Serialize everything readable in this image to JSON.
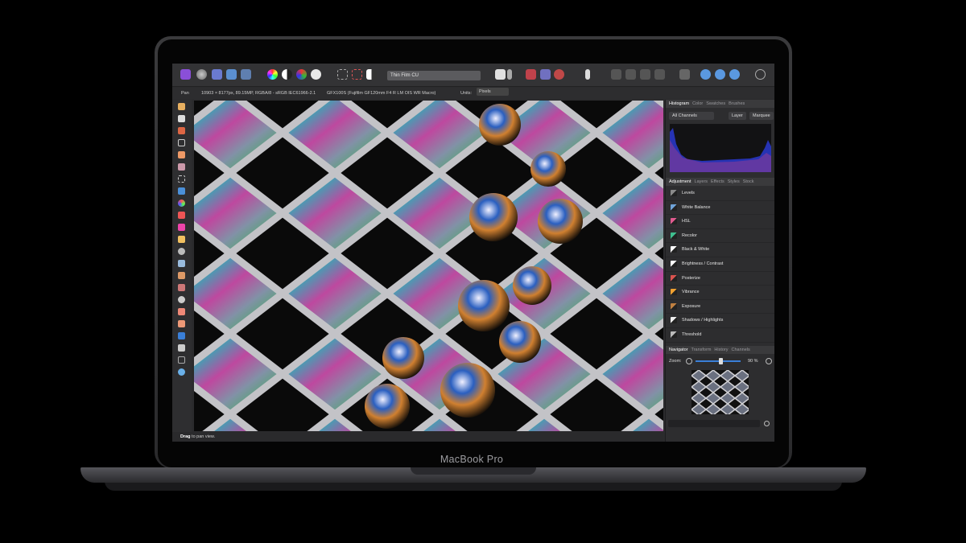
{
  "device": {
    "brand_label": "MacBook Pro"
  },
  "toolbar": {
    "search_value": "Thin Film CU"
  },
  "context": {
    "tool": "Pan",
    "doc_info": "10903 × 8177px, 89.15MP, RGBA/8 - sRGB IEC61966-2.1",
    "camera": "GFX100S (Fujifilm GF120mm F4 R LM OIS WR Macro)",
    "units_label": "Units:",
    "units_value": "Pixels"
  },
  "status": {
    "bold": "Drag",
    "text": " to pan view."
  },
  "histogram_panel": {
    "tabs": [
      "Histogram",
      "Color",
      "Swatches",
      "Brushes"
    ],
    "channel": "All Channels",
    "layer_label": "Layer",
    "marquee_label": "Marquee"
  },
  "adjustment_panel": {
    "tabs": [
      "Adjustment",
      "Layers",
      "Effects",
      "Styles",
      "Stock"
    ],
    "items": [
      {
        "label": "Levels",
        "color": "#8a8a8a"
      },
      {
        "label": "White Balance",
        "color": "#6fa3d8"
      },
      {
        "label": "HSL",
        "color": "#e05a8f"
      },
      {
        "label": "Recolor",
        "color": "#3fbf8f"
      },
      {
        "label": "Black & White",
        "color": "#ffffff"
      },
      {
        "label": "Brightness / Contrast",
        "color": "#ffffff"
      },
      {
        "label": "Posterize",
        "color": "#d9534f"
      },
      {
        "label": "Vibrance",
        "color": "#f0a030"
      },
      {
        "label": "Exposure",
        "color": "#c08040"
      },
      {
        "label": "Shadows / Highlights",
        "color": "#eeeeee"
      },
      {
        "label": "Threshold",
        "color": "#bbbbbb"
      }
    ]
  },
  "navigator_panel": {
    "tabs": [
      "Navigator",
      "Transform",
      "History",
      "Channels"
    ],
    "zoom_label": "Zoom:",
    "zoom_value": "90 %"
  },
  "colors": {
    "accent": "#8a4fd8",
    "panel_bg": "#2d2d2f",
    "toolbar_bg": "#333335"
  }
}
